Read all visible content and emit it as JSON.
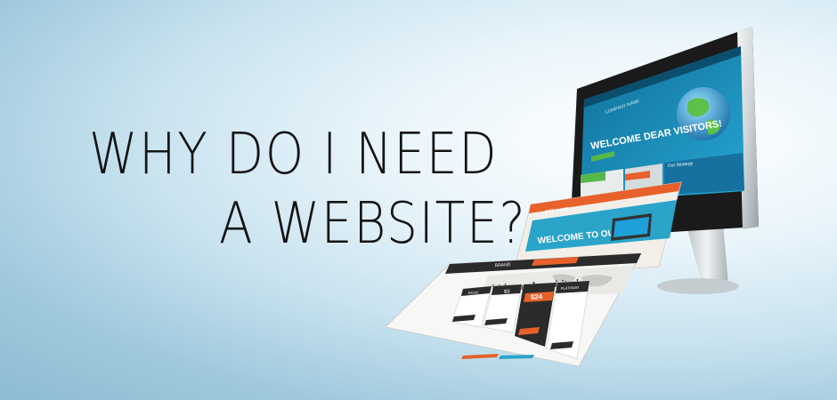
{
  "headline": {
    "line1": "WHY DO I NEED",
    "line2": "A WEBSITE?"
  },
  "monitor": {
    "screen_heading": "WELCOME DEAR VISITORS!",
    "site_name": "COMPANY NAME",
    "panel_label": "Our Strategy"
  },
  "page_back": {
    "site_name": "SITE NAME",
    "banner": "WELCOME TO OUR SITE"
  },
  "page_front": {
    "brand": "BRAND",
    "welcome": "Welcome dear visitor!",
    "plans": [
      "BASIC",
      "$",
      "GOLD",
      "PLATINUM"
    ],
    "prices": [
      "",
      "$9",
      "$24",
      ""
    ]
  },
  "colors": {
    "accent_orange": "#e8602a",
    "screen_blue": "#1a8cb8",
    "accent_green": "#57b84a",
    "dark": "#2b2b2b"
  }
}
